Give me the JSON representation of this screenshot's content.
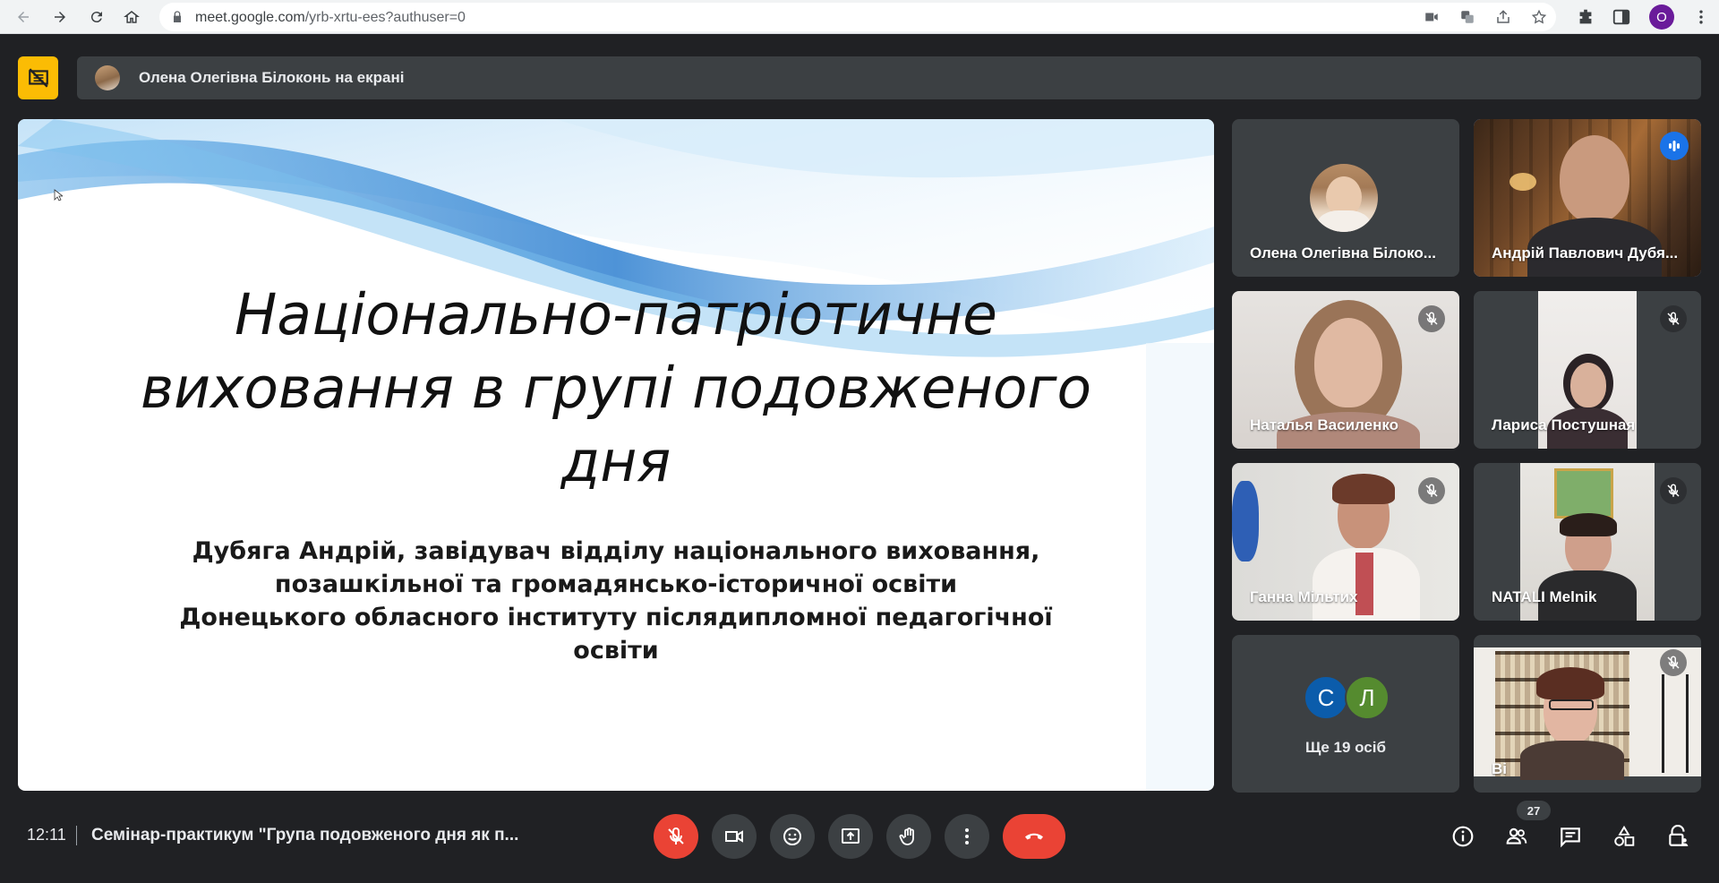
{
  "browser": {
    "url_host": "meet.google.com",
    "url_path": "/yrb-xrtu-ees?authuser=0",
    "profile_initial": "O"
  },
  "presenting": {
    "text": "Олена Олегівна Білоконь на екрані"
  },
  "slide": {
    "title_lines": [
      "Національно-патріотичне",
      "виховання в групі подовженого",
      "дня"
    ],
    "subtitle_lines": [
      "Дубяга Андрій, завідувач відділу національного виховання,",
      "позашкільної та громадянсько-історичної освіти",
      "Донецького обласного інституту післядипломної педагогічної",
      "освіти"
    ]
  },
  "participants": [
    {
      "name": "Олена Олегівна Білоко...",
      "muted": false
    },
    {
      "name": "Андрій Павлович Дубя...",
      "speaking": true
    },
    {
      "name": "Наталья Василенко",
      "muted": true
    },
    {
      "name": "Лариса Постушная",
      "muted": true
    },
    {
      "name": "Ганна Мільтих",
      "muted": true
    },
    {
      "name": "NATALI Melnik",
      "muted": true
    },
    {
      "more_text": "Ще 19 осіб",
      "initials": [
        "С",
        "Л"
      ]
    },
    {
      "name": "Ві",
      "muted": true
    }
  ],
  "bottom": {
    "time": "12:11",
    "meeting_title": "Семінар-практикум \"Група подовженого дня як п...",
    "people_count": "27"
  },
  "colors": {
    "background": "#202124",
    "tile": "#3c4043",
    "red": "#ea4335",
    "present_badge": "#fbbc04",
    "speaking_blue": "#1a73e8",
    "letter_c": "#0b5cab",
    "letter_l": "#558b2f"
  }
}
